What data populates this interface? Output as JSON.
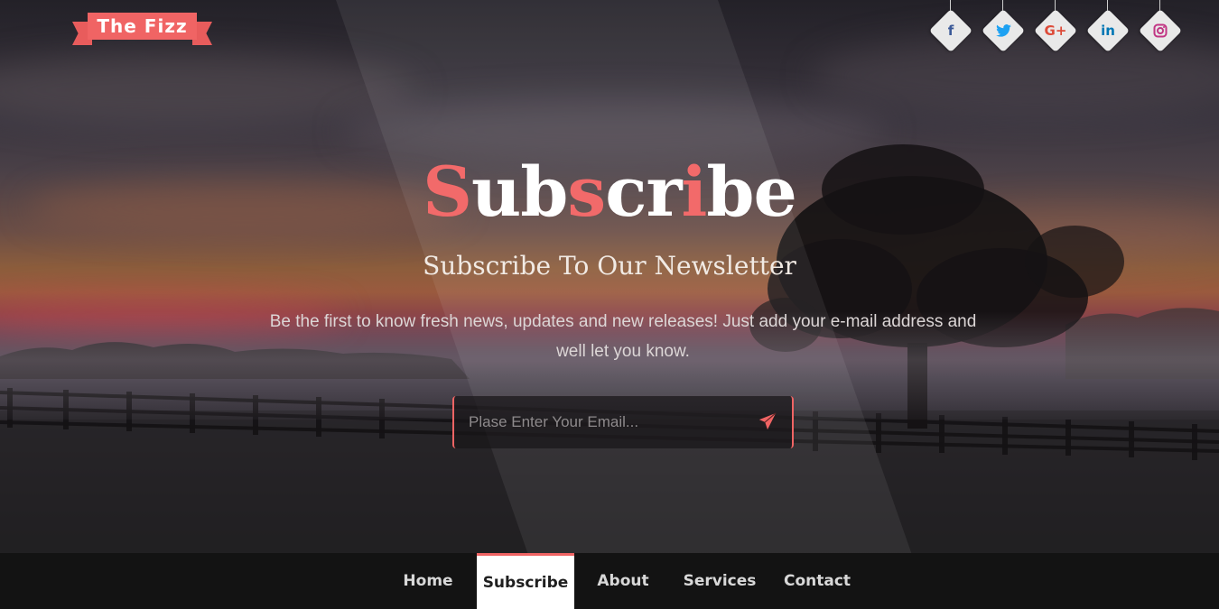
{
  "brand": {
    "logo_text": "The Fizz",
    "accent_color": "#f06464"
  },
  "social": [
    {
      "icon": "facebook-icon",
      "glyph": "f",
      "color": "#3b5998"
    },
    {
      "icon": "twitter-icon",
      "glyph": "🐦",
      "color": "#1da1f2"
    },
    {
      "icon": "google-plus-icon",
      "glyph": "G+",
      "color": "#dd4b39"
    },
    {
      "icon": "linkedin-icon",
      "glyph": "in",
      "color": "#0077b5"
    },
    {
      "icon": "instagram-icon",
      "glyph": "◎",
      "color": "#c13584"
    }
  ],
  "hero": {
    "title_parts": [
      "S",
      "ub",
      "s",
      "cr",
      "i",
      "be"
    ],
    "subtitle": "Subscribe To Our Newsletter",
    "description": "Be the first to know fresh news, updates and new releases! Just add your e-mail address and well let you know."
  },
  "form": {
    "email_placeholder": "Plase Enter Your Email...",
    "email_value": "",
    "send_icon": "paper-plane-icon"
  },
  "nav": {
    "items": [
      "Home",
      "Subscribe",
      "About",
      "Services",
      "Contact"
    ],
    "active": "Subscribe"
  }
}
